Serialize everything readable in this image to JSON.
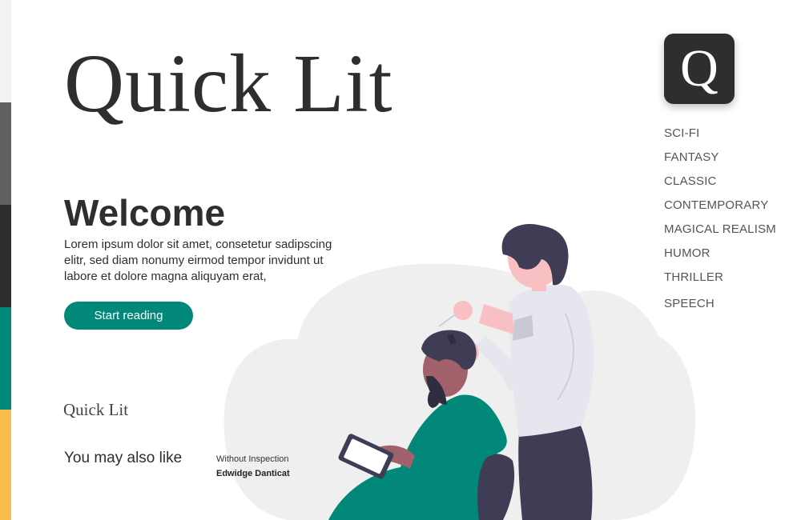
{
  "brand": {
    "title": "Quick Lit",
    "icon_letter": "Q",
    "footer_logo": "Quick Lit"
  },
  "hero": {
    "heading": "Welcome",
    "body": "Lorem ipsum dolor sit amet, consetetur sadipscing elitr, sed diam nonumy eirmod tempor invidunt ut labore et dolore magna aliquyam erat,",
    "cta_label": "Start reading"
  },
  "genres": [
    "SCI-FI",
    "FANTASY",
    "CLASSIC",
    "CONTEMPORARY",
    "MAGICAL REALISM",
    "HUMOR",
    "THRILLER",
    "SPEECH"
  ],
  "recommendations": {
    "heading": "You may also like",
    "books": [
      {
        "title": "Without Inspection",
        "author": "Edwidge Danticat"
      }
    ]
  },
  "colors": {
    "accent": "#018878",
    "dark": "#2e2e2e",
    "strip": [
      "#f2f2f2",
      "#5f6062",
      "#2e2e2e",
      "#018878",
      "#f9bd4c"
    ],
    "illustration_bg": "#eeefee"
  }
}
